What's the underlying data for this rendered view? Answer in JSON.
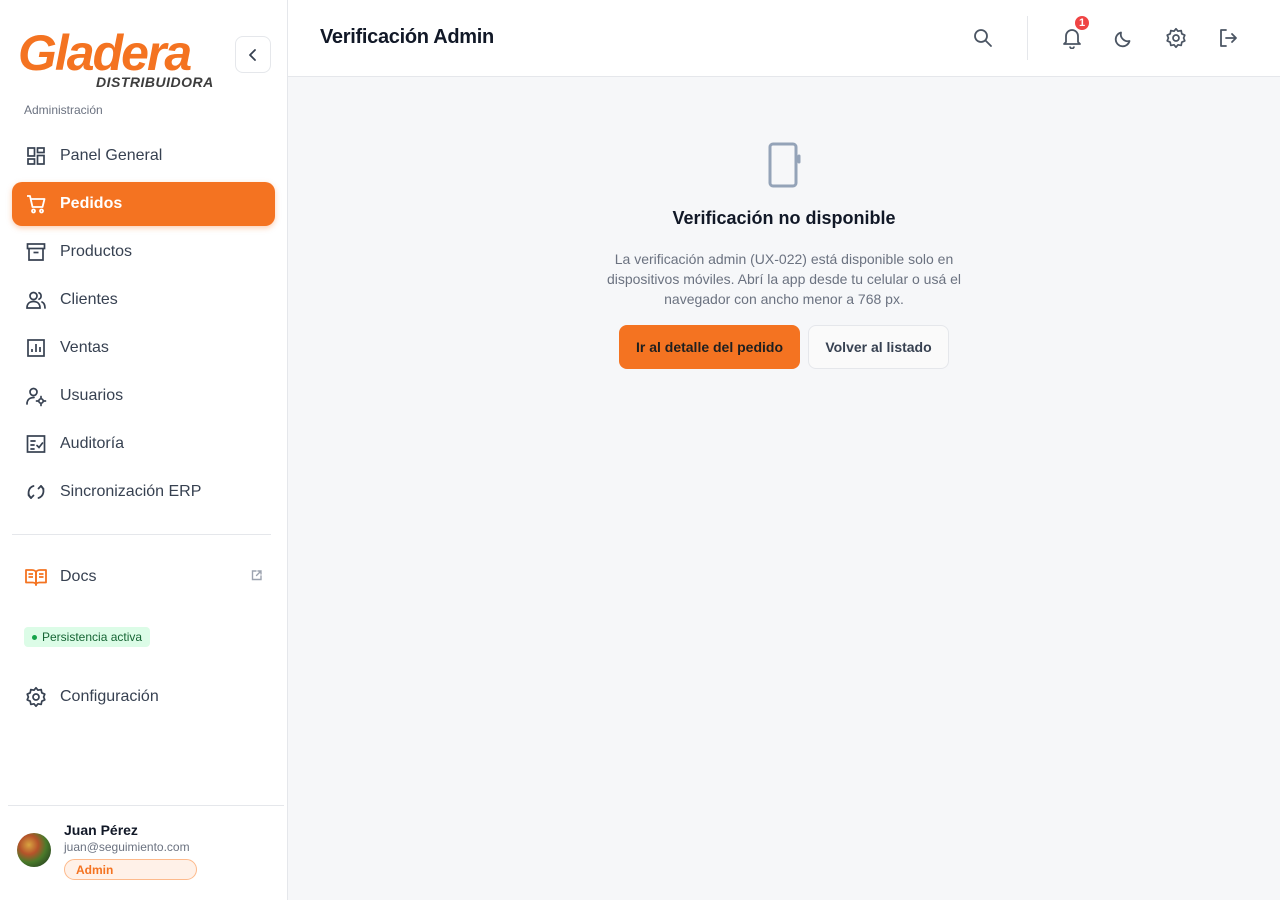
{
  "brand": {
    "name": "Gladera",
    "subtitle": "DISTRIBUIDORA",
    "section": "Administración",
    "accent": "#f47321"
  },
  "sidebar": {
    "items": [
      {
        "label": "Panel General",
        "icon": "dashboard-icon",
        "active": false
      },
      {
        "label": "Pedidos",
        "icon": "cart-icon",
        "active": true
      },
      {
        "label": "Productos",
        "icon": "archive-icon",
        "active": false
      },
      {
        "label": "Clientes",
        "icon": "users-icon",
        "active": false
      },
      {
        "label": "Ventas",
        "icon": "chart-icon",
        "active": false
      },
      {
        "label": "Usuarios",
        "icon": "user-gear-icon",
        "active": false
      },
      {
        "label": "Auditoría",
        "icon": "checklist-icon",
        "active": false
      },
      {
        "label": "Sincronización ERP",
        "icon": "sync-icon",
        "active": false
      }
    ],
    "docs": {
      "label": "Docs",
      "icon": "book-icon"
    },
    "persistence_badge": "Persistencia activa",
    "config": {
      "label": "Configuración",
      "icon": "gear-icon"
    }
  },
  "user": {
    "name": "Juan Pérez",
    "email": "juan@seguimiento.com",
    "role": "Admin"
  },
  "header": {
    "title": "Verificación Admin",
    "notification_count": "1"
  },
  "main": {
    "title": "Verificación no disponible",
    "description": "La verificación admin (UX-022) está disponible solo en dispositivos móviles. Abrí la app desde tu celular o usá el navegador con ancho menor a 768 px.",
    "primary_button": "Ir al detalle del pedido",
    "secondary_button": "Volver al listado"
  }
}
